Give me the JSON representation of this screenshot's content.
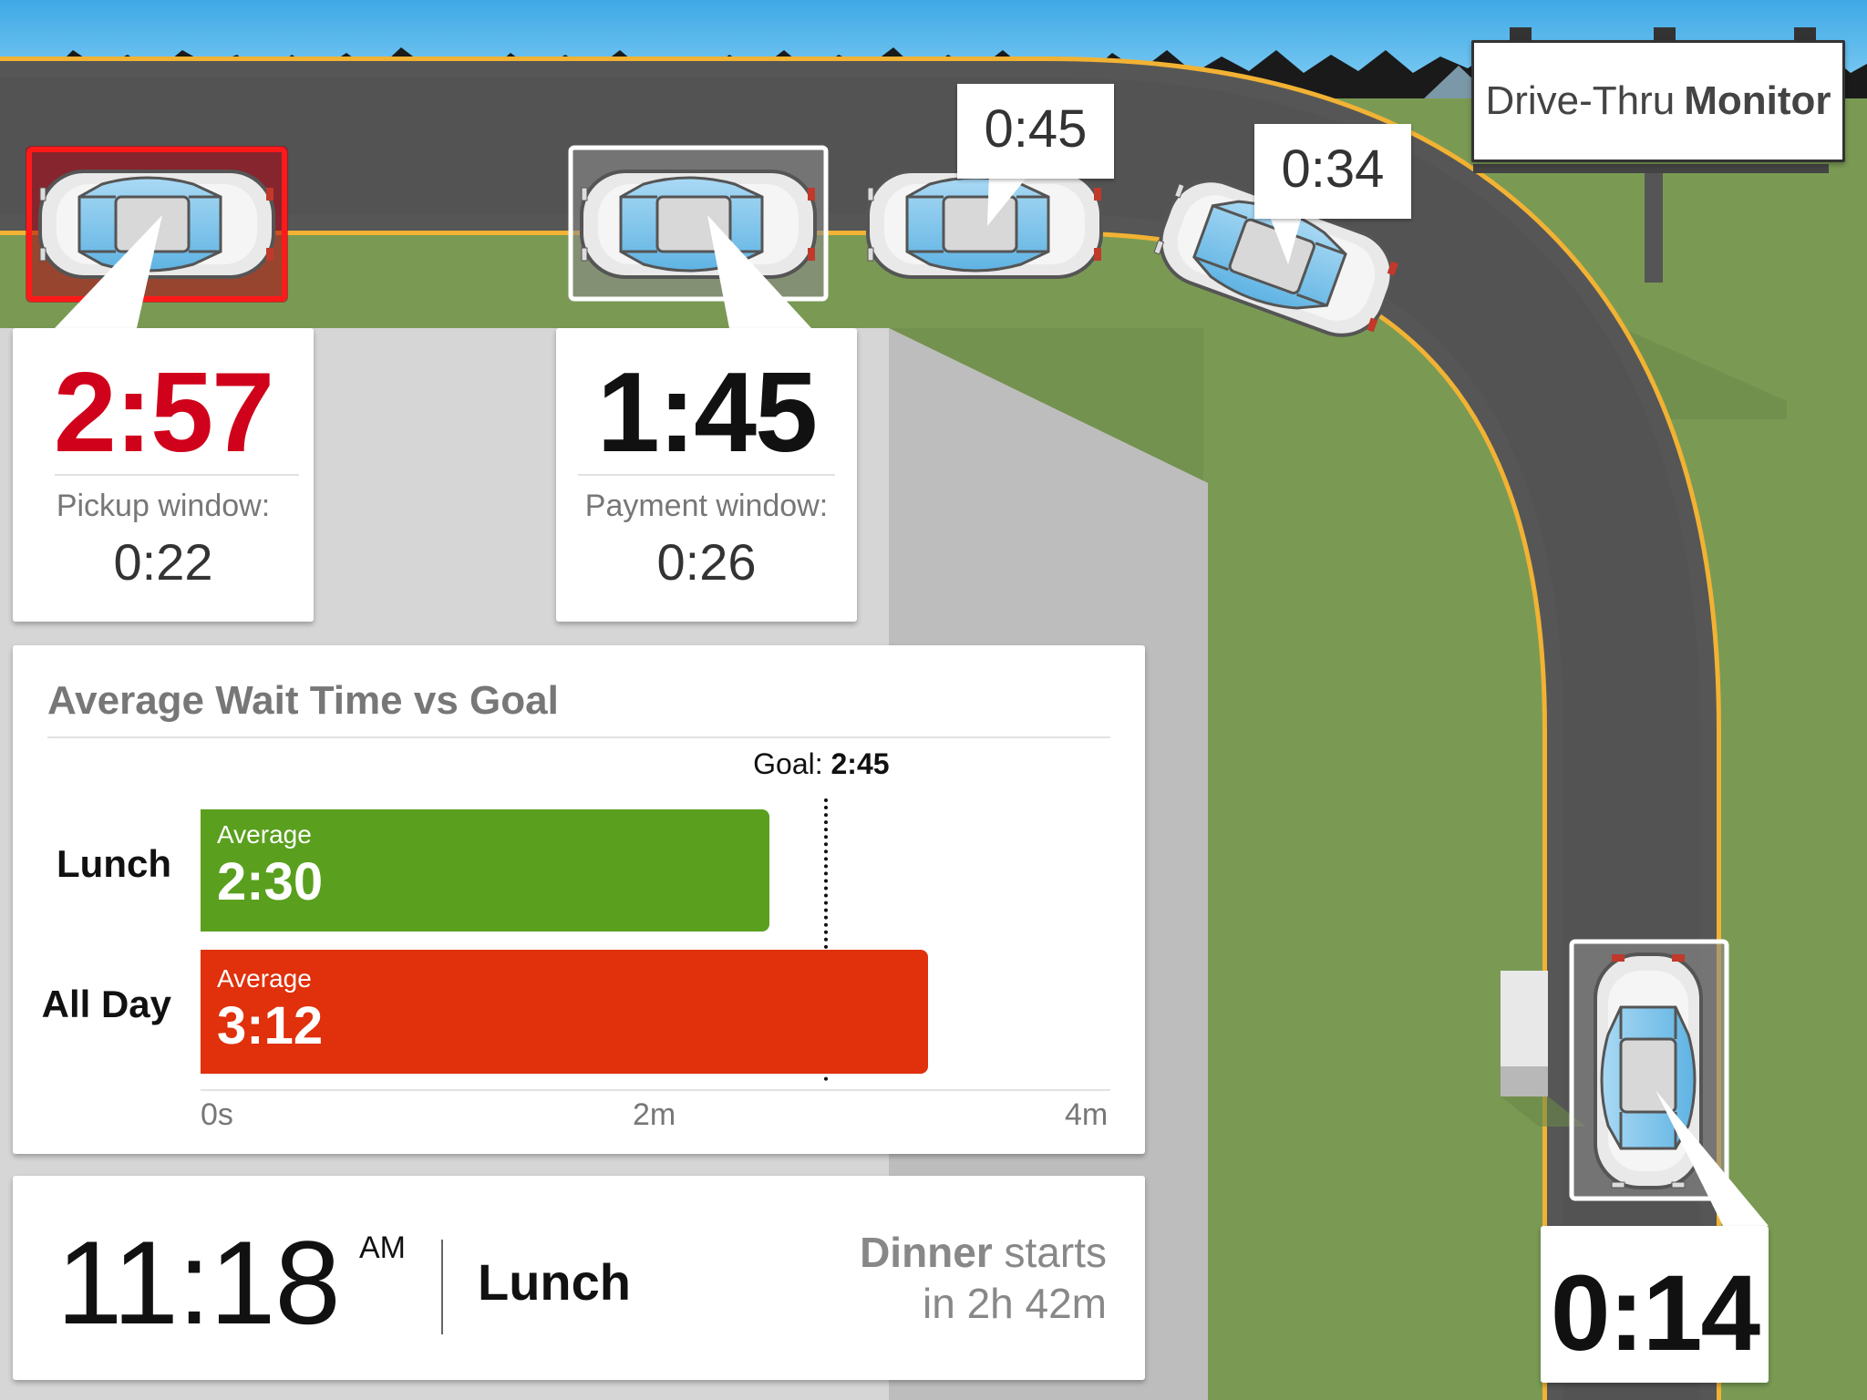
{
  "colors": {
    "sky": "#4fb3e8",
    "grass": "#7a9a54",
    "road": "#565656",
    "lane_line": "#f2b233",
    "alert_red": "#d0021b",
    "goal_green": "#5aa01e",
    "over_red": "#e0300c"
  },
  "billboard": {
    "title_light": "Drive-Thru",
    "title_bold": "Monitor"
  },
  "cars": [
    {
      "id": "pickup",
      "timer": "2:57",
      "status": "alert"
    },
    {
      "id": "payment",
      "timer": "1:45",
      "status": "selected"
    },
    {
      "id": "queue-3",
      "timer": "0:45",
      "status": "normal"
    },
    {
      "id": "queue-4",
      "timer": "0:34",
      "status": "normal"
    },
    {
      "id": "order",
      "timer": "0:14",
      "status": "selected"
    }
  ],
  "pickup_card": {
    "time": "2:57",
    "label": "Pickup window:",
    "window_time": "0:22"
  },
  "payment_card": {
    "time": "1:45",
    "label": "Payment window:",
    "window_time": "0:26"
  },
  "order_card": {
    "time": "0:14"
  },
  "chart_card": {
    "title": "Average Wait Time vs Goal"
  },
  "chart_data": {
    "type": "bar",
    "orientation": "horizontal",
    "title": "Average Wait Time vs Goal",
    "categories": [
      "Lunch",
      "All Day"
    ],
    "values_seconds": [
      150,
      192
    ],
    "bar_labels": [
      "Average",
      "Average"
    ],
    "value_labels": [
      "2:30",
      "3:12"
    ],
    "bar_colors": [
      "#5aa01e",
      "#e0300c"
    ],
    "goal_seconds": 165,
    "goal_label": "Goal:",
    "goal_value": "2:45",
    "xlim_seconds": [
      0,
      240
    ],
    "xticks": [
      {
        "value": 0,
        "label": "0s"
      },
      {
        "value": 120,
        "label": "2m"
      },
      {
        "value": 240,
        "label": "4m"
      }
    ]
  },
  "clock": {
    "time": "11:18",
    "ampm": "AM",
    "period": "Lunch",
    "next_meal": "Dinner",
    "next_text": "starts",
    "next_in": "in 2h 42m"
  }
}
